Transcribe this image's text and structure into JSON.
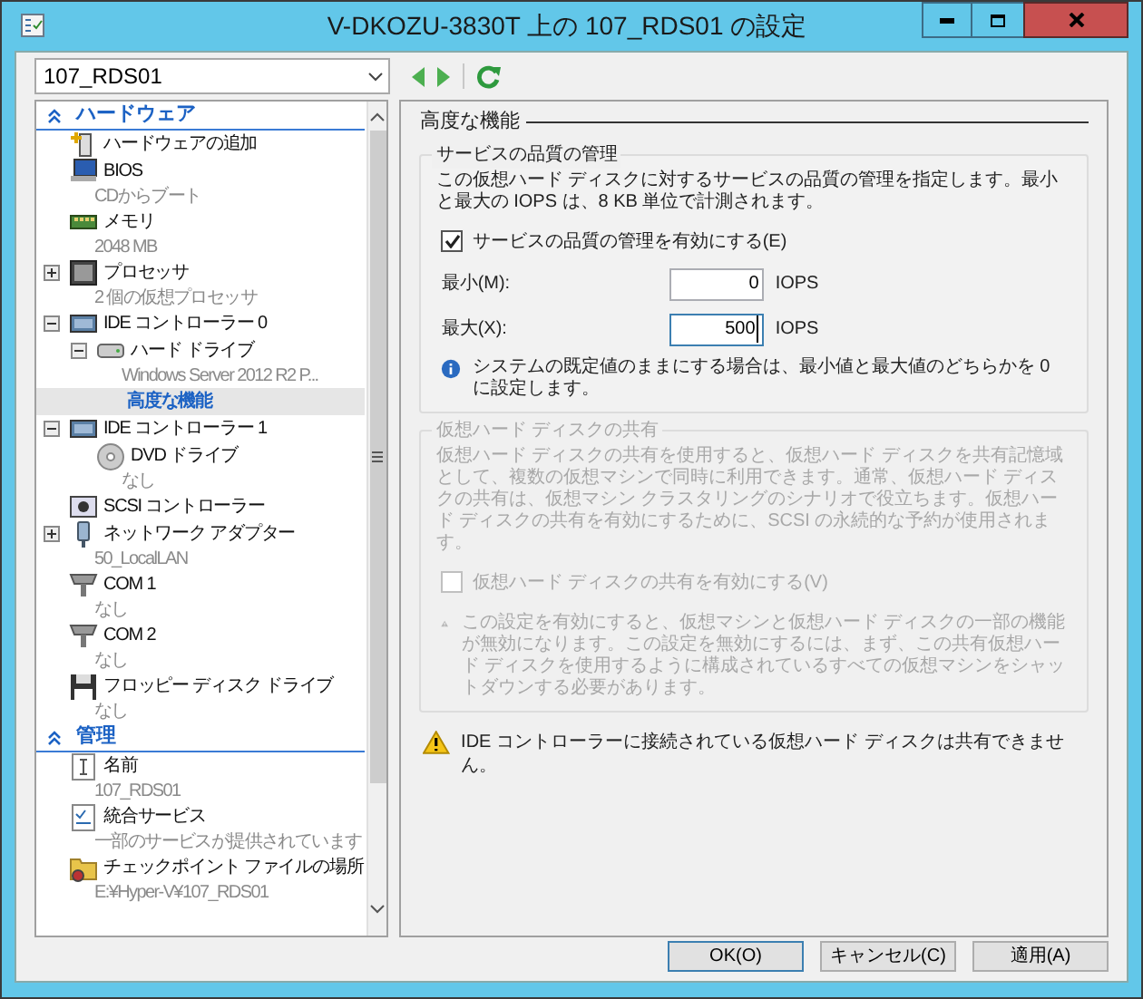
{
  "window": {
    "title": "V-DKOZU-3830T 上の 107_RDS01 の設定"
  },
  "vm_selector": {
    "value": "107_RDS01"
  },
  "tree": {
    "sections": [
      {
        "title": "ハードウェア",
        "expanded": true,
        "items": [
          {
            "kind": "add-hardware",
            "label": "ハードウェアの追加",
            "selected": false
          },
          {
            "kind": "bios",
            "label": "BIOS",
            "detail": "CDからブート",
            "selected": false
          },
          {
            "kind": "memory",
            "label": "メモリ",
            "detail": "2048 MB",
            "selected": false
          },
          {
            "kind": "processor",
            "label": "プロセッサ",
            "detail": "2 個の仮想プロセッサ",
            "expanded": false,
            "selected": false
          },
          {
            "kind": "controller",
            "label": "IDE コントローラー 0",
            "expanded": true,
            "selected": false,
            "children": [
              {
                "kind": "disk",
                "label": "ハード ドライブ",
                "detail": "Windows Server 2012 R2 P...",
                "expanded": true,
                "selected": false,
                "children": [
                  {
                    "label": "高度な機能",
                    "selected": true
                  }
                ]
              }
            ]
          },
          {
            "kind": "controller",
            "label": "IDE コントローラー 1",
            "expanded": true,
            "selected": false,
            "children": [
              {
                "kind": "dvd",
                "label": "DVD ドライブ",
                "detail": "なし",
                "selected": false
              }
            ]
          },
          {
            "kind": "scsi",
            "label": "SCSI コントローラー",
            "selected": false
          },
          {
            "kind": "network",
            "label": "ネットワーク アダプター",
            "detail": "50_LocalLAN",
            "expanded": false,
            "selected": false
          },
          {
            "kind": "com",
            "label": "COM 1",
            "detail": "なし",
            "selected": false
          },
          {
            "kind": "com",
            "label": "COM 2",
            "detail": "なし",
            "selected": false
          },
          {
            "kind": "floppy",
            "label": "フロッピー ディスク ドライブ",
            "detail": "なし",
            "selected": false
          }
        ]
      },
      {
        "title": "管理",
        "expanded": true,
        "items": [
          {
            "kind": "name",
            "label": "名前",
            "detail": "107_RDS01",
            "selected": false
          },
          {
            "kind": "services",
            "label": "統合サービス",
            "detail": "一部のサービスが提供されています",
            "selected": false
          },
          {
            "kind": "checkpoint",
            "label": "チェックポイント ファイルの場所",
            "detail": "E:¥Hyper-V¥107_RDS01",
            "selected": false
          }
        ]
      }
    ]
  },
  "panel": {
    "title": "高度な機能",
    "qos": {
      "title": "サービスの品質の管理",
      "disabled": false,
      "description": "この仮想ハード ディスクに対するサービスの品質の管理を指定します。最小と最大の IOPS は、8 KB 単位で計測されます。",
      "enable": {
        "label": "サービスの品質の管理を有効にする(E)",
        "checked": true
      },
      "fields": [
        {
          "label": "最小(M):",
          "value": "0",
          "unit": "IOPS",
          "focused": false
        },
        {
          "label": "最大(X):",
          "value": "500",
          "unit": "IOPS",
          "focused": true
        }
      ],
      "info": "システムの既定値のままにする場合は、最小値と最大値のどちらかを 0 に設定します。"
    },
    "sharing": {
      "title": "仮想ハード ディスクの共有",
      "disabled": true,
      "description": "仮想ハード ディスクの共有を使用すると、仮想ハード ディスクを共有記憶域として、複数の仮想マシンで同時に利用できます。通常、仮想ハード ディスクの共有は、仮想マシン クラスタリングのシナリオで役立ちます。仮想ハード ディスクの共有を有効にするために、SCSI の永続的な予約が使用されます。",
      "enable": {
        "label": "仮想ハード ディスクの共有を有効にする(V)",
        "checked": false
      },
      "warning": "この設定を有効にすると、仮想マシンと仮想ハード ディスクの一部の機能が無効になります。この設定を無効にするには、まず、この共有仮想ハード ディスクを使用するように構成されているすべての仮想マシンをシャットダウンする必要があります。"
    },
    "note": "IDE コントローラーに接続されている仮想ハード ディスクは共有できません。"
  },
  "buttons": [
    {
      "label": "OK(O)",
      "default": true
    },
    {
      "label": "キャンセル(C)",
      "default": false
    },
    {
      "label": "適用(A)",
      "default": false
    }
  ]
}
